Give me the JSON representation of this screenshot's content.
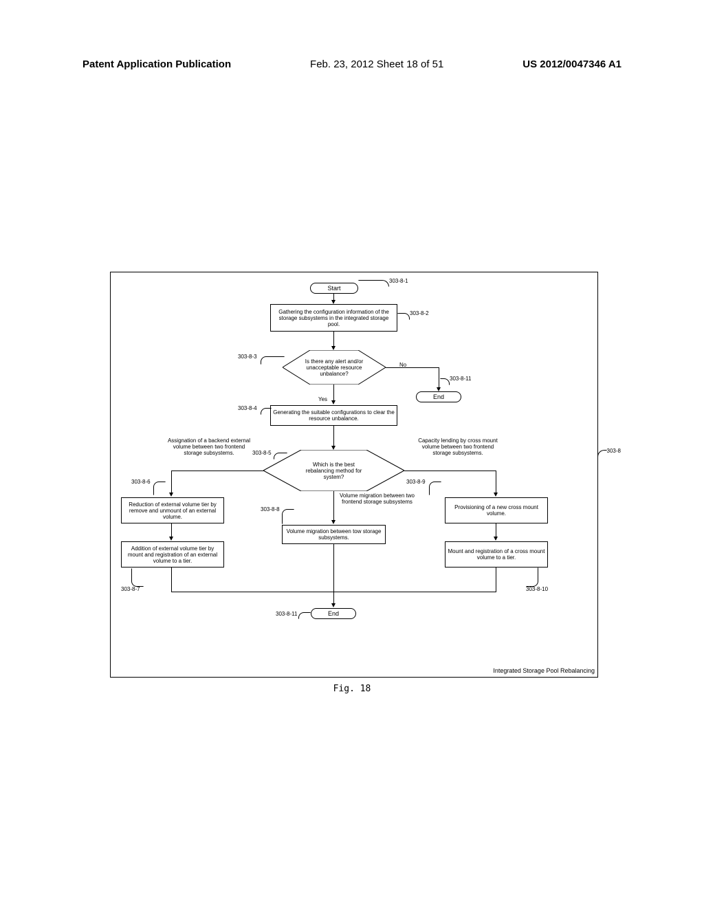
{
  "header": {
    "left": "Patent Application Publication",
    "center": "Feb. 23, 2012  Sheet 18 of 51",
    "right": "US 2012/0047346 A1"
  },
  "figure_caption": "Fig. 18",
  "refs": {
    "start": "303-8-1",
    "gather": "303-8-2",
    "alert": "303-8-3",
    "generate": "303-8-4",
    "which": "303-8-5",
    "reduction": "303-8-6",
    "addition": "303-8-7",
    "migrate": "303-8-8",
    "cross": "303-8-9",
    "mount": "303-8-10",
    "end_right": "303-8-11",
    "end_bottom": "303-8-11",
    "container": "303-8"
  },
  "steps": {
    "start": "Start",
    "gather": "Gathering the configuration information of the storage subsystems in the integrated storage pool.",
    "alert": "Is there any alert and/or unacceptable resource unbalance?",
    "generate": "Generating the suitable configurations to clear the resource unbalance.",
    "which": "Which is the best rebalancing method for system?",
    "reduction": "Reduction of external volume tier by remove and unmount of an external volume.",
    "addition": "Addition of external volume tier by mount and registration of an external volume to a tier.",
    "migrate": "Volume migration between tow storage subsystems.",
    "provision": "Provisioning of a new cross mount volume.",
    "mount": "Mount and registration of a cross mount volume to a tier.",
    "end": "End"
  },
  "paths": {
    "yes": "Yes",
    "no": "No",
    "left": "Assignation of a backend external volume between two frontend storage subsystems.",
    "center": "Volume migration between two frontend storage subsystems",
    "right": "Capacity lending by cross mount volume between two frontend storage subsystems."
  },
  "corner": "Integrated Storage Pool Rebalancing"
}
